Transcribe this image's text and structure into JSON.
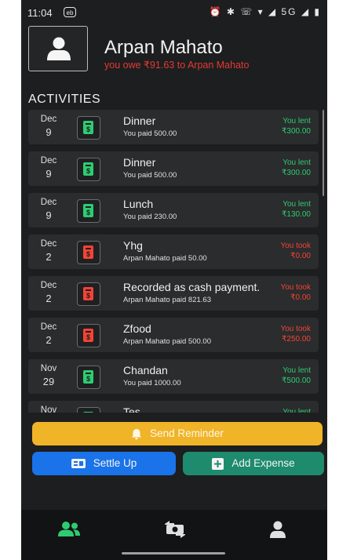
{
  "status": {
    "time": "11:04",
    "app_badge": "eb",
    "sys_icons": "⏰ ✱ ☏ ▾ ◢ 5G ◢ ▮"
  },
  "header": {
    "name": "Arpan Mahato",
    "owe_text": "you owe ₹91.63  to Arpan Mahato"
  },
  "section_title": "ACTIVITIES",
  "activities": [
    {
      "month": "Dec",
      "day": "9",
      "title": "Dinner",
      "sub": "You paid 500.00",
      "status": "You lent",
      "amount": "₹300.00",
      "tone": "green"
    },
    {
      "month": "Dec",
      "day": "9",
      "title": "Dinner",
      "sub": "You paid 500.00",
      "status": "You lent",
      "amount": "₹300.00",
      "tone": "green"
    },
    {
      "month": "Dec",
      "day": "9",
      "title": "Lunch",
      "sub": "You paid 230.00",
      "status": "You lent",
      "amount": "₹130.00",
      "tone": "green"
    },
    {
      "month": "Dec",
      "day": "2",
      "title": "Yhg",
      "sub": "Arpan Mahato paid 50.00",
      "status": "You took",
      "amount": "₹0.00",
      "tone": "red"
    },
    {
      "month": "Dec",
      "day": "2",
      "title": "Recorded as cash payment.",
      "sub": "Arpan Mahato paid 821.63",
      "status": "You took",
      "amount": "₹0.00",
      "tone": "red"
    },
    {
      "month": "Dec",
      "day": "2",
      "title": "Zfood",
      "sub": "Arpan Mahato paid 500.00",
      "status": "You took",
      "amount": "₹250.00",
      "tone": "red"
    },
    {
      "month": "Nov",
      "day": "29",
      "title": "Chandan",
      "sub": "You paid 1000.00",
      "status": "You lent",
      "amount": "₹500.00",
      "tone": "green"
    },
    {
      "month": "Nov",
      "day": "",
      "title": "Tes",
      "sub": "",
      "status": "You lent",
      "amount": "",
      "tone": "green"
    }
  ],
  "buttons": {
    "reminder": "Send Reminder",
    "settle": "Settle Up",
    "add": "Add Expense"
  },
  "colors": {
    "lent": "#2ecc71",
    "took": "#f44336",
    "reminder_bg": "#f0b429",
    "settle_bg": "#1a73e8",
    "add_bg": "#1e8a6e"
  },
  "nav": {
    "items": [
      "friends-icon",
      "money-exchange-icon",
      "profile-icon"
    ]
  }
}
